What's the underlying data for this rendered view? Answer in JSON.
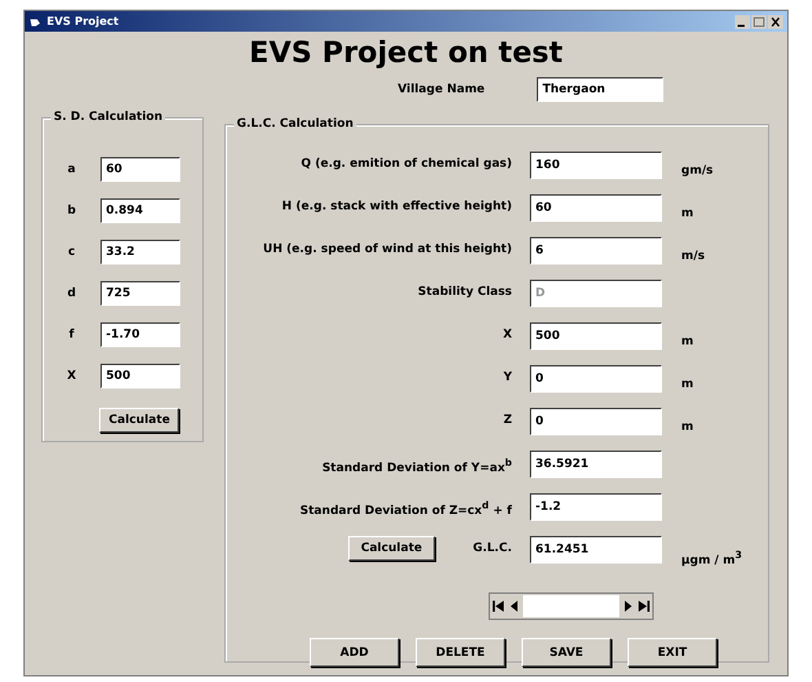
{
  "window": {
    "title": "EVS Project"
  },
  "heading": "EVS Project on test",
  "village": {
    "label": "Village Name",
    "value": "Thergaon"
  },
  "sd_calculation": {
    "title": "S. D. Calculation",
    "rows": [
      {
        "label": "a",
        "value": "60"
      },
      {
        "label": "b",
        "value": "0.894"
      },
      {
        "label": "c",
        "value": "33.2"
      },
      {
        "label": "d",
        "value": "725"
      },
      {
        "label": "f",
        "value": "-1.70"
      },
      {
        "label": "X",
        "value": "500"
      }
    ],
    "button": "Calculate"
  },
  "glc_calculation": {
    "title": "G.L.C. Calculation",
    "rows": [
      {
        "label": "Q (e.g. emition of chemical gas)",
        "value": "160",
        "unit": "gm/s",
        "disabled": false
      },
      {
        "label": "H (e.g. stack with effective height)",
        "value": "60",
        "unit": "m",
        "disabled": false
      },
      {
        "label": "UH (e.g. speed of wind at this height)",
        "value": "6",
        "unit": "m/s",
        "disabled": false
      },
      {
        "label": "Stability Class",
        "value": "D",
        "disabled": true
      },
      {
        "label": "X",
        "value": "500",
        "unit": "m",
        "disabled": false
      },
      {
        "label": "Y",
        "value": "0",
        "unit": "m",
        "disabled": false
      },
      {
        "label": "Z",
        "value": "0",
        "unit": "m",
        "disabled": false
      },
      {
        "label": "Standard Deviation of Y=ax$^{b}$",
        "value": "36.5921",
        "disabled": false
      },
      {
        "label": "Standard Deviation of Z=cx$^{d}$ + f",
        "value": "-1.2",
        "disabled": false
      }
    ],
    "calculate_button": "Calculate",
    "result": {
      "label": "G.L.C.",
      "value": "61.2451",
      "unit": "μgm / m$^{3}$"
    }
  },
  "buttons": [
    "ADD",
    "DELETE",
    "SAVE",
    "EXIT"
  ]
}
